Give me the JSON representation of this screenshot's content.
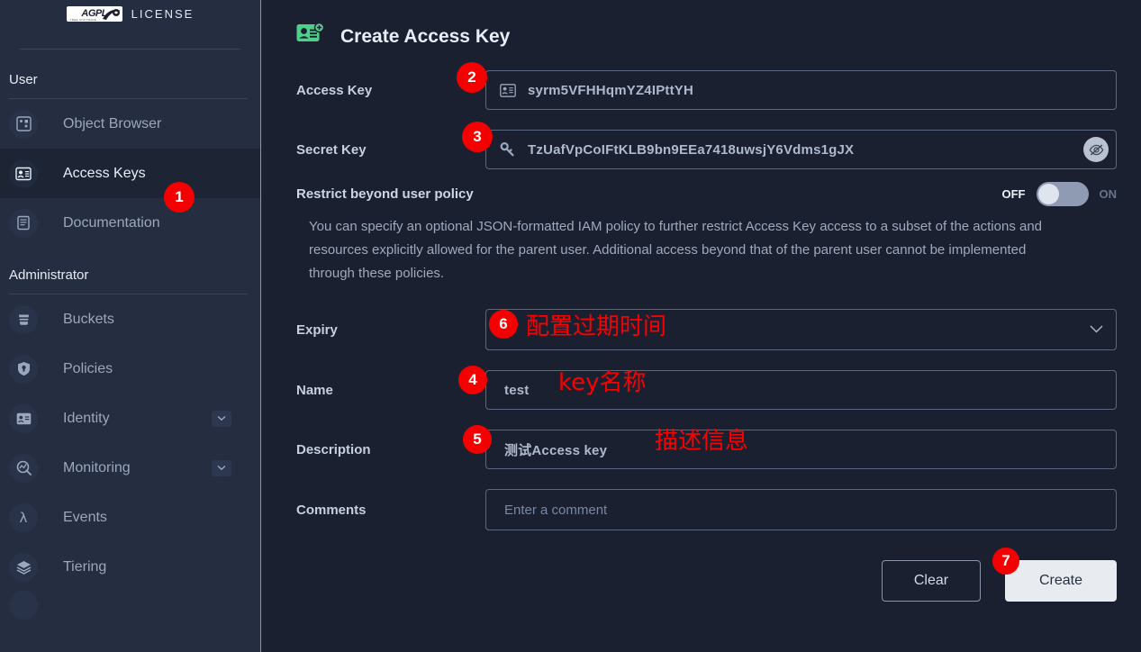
{
  "sidebar": {
    "license_badge": "AGPL",
    "license_badge_sub": "FREE SOFTWARE",
    "license_label": "LICENSE",
    "sections": [
      {
        "title": "User",
        "items": [
          {
            "label": "Object Browser",
            "icon": "object-browser-icon",
            "active": false,
            "expandable": false
          },
          {
            "label": "Access Keys",
            "icon": "access-keys-icon",
            "active": true,
            "expandable": false
          },
          {
            "label": "Documentation",
            "icon": "documentation-icon",
            "active": false,
            "expandable": false
          }
        ]
      },
      {
        "title": "Administrator",
        "items": [
          {
            "label": "Buckets",
            "icon": "bucket-icon",
            "active": false,
            "expandable": false
          },
          {
            "label": "Policies",
            "icon": "lock-icon",
            "active": false,
            "expandable": false
          },
          {
            "label": "Identity",
            "icon": "identity-card-icon",
            "active": false,
            "expandable": true
          },
          {
            "label": "Monitoring",
            "icon": "monitoring-icon",
            "active": false,
            "expandable": true
          },
          {
            "label": "Events",
            "icon": "lambda-icon",
            "active": false,
            "expandable": false
          },
          {
            "label": "Tiering",
            "icon": "layers-icon",
            "active": false,
            "expandable": false
          }
        ]
      }
    ]
  },
  "page": {
    "title": "Create Access Key",
    "title_icon": "create-access-key-icon"
  },
  "form": {
    "access_key": {
      "label": "Access Key",
      "value": "syrm5VFHHqmYZ4IPttYH",
      "icon": "id-card-icon"
    },
    "secret_key": {
      "label": "Secret Key",
      "value": "TzUafVpCoIFtKLB9bn9EEa7418uwsjY6Vdms1gJX",
      "icon": "key-icon",
      "reveal_icon": "eye-off-icon"
    },
    "restrict": {
      "label": "Restrict beyond user policy",
      "off_label": "OFF",
      "on_label": "ON",
      "state": "off",
      "helper": "You can specify an optional JSON-formatted IAM policy to further restrict Access Key access to a subset of the actions and resources explicitly allowed for the parent user. Additional access beyond that of the parent user cannot be implemented through these policies."
    },
    "expiry": {
      "label": "Expiry",
      "value": "",
      "chevron_icon": "chevron-down-icon"
    },
    "name": {
      "label": "Name",
      "value": "test",
      "placeholder": ""
    },
    "description": {
      "label": "Description",
      "value": "测试Access key",
      "placeholder": ""
    },
    "comments": {
      "label": "Comments",
      "value": "",
      "placeholder": "Enter a comment"
    },
    "clear_button": "Clear",
    "create_button": "Create"
  },
  "annotations": {
    "markers": [
      {
        "id": "1",
        "target": "sidebar-item-access-keys"
      },
      {
        "id": "2",
        "target": "access-key-field"
      },
      {
        "id": "3",
        "target": "secret-key-field"
      },
      {
        "id": "4",
        "target": "name-field"
      },
      {
        "id": "5",
        "target": "description-field"
      },
      {
        "id": "6",
        "target": "expiry-field"
      },
      {
        "id": "7",
        "target": "create-button"
      }
    ],
    "notes": [
      {
        "text": "配置过期时间",
        "target": "expiry-field"
      },
      {
        "text": "key名称",
        "target": "name-field"
      },
      {
        "text": "描述信息",
        "target": "description-field"
      }
    ]
  },
  "colors": {
    "accent_green": "#4ed08a",
    "annotation_red": "#f40000",
    "sidebar_bg": "#252e40",
    "main_bg": "#1a2030"
  }
}
